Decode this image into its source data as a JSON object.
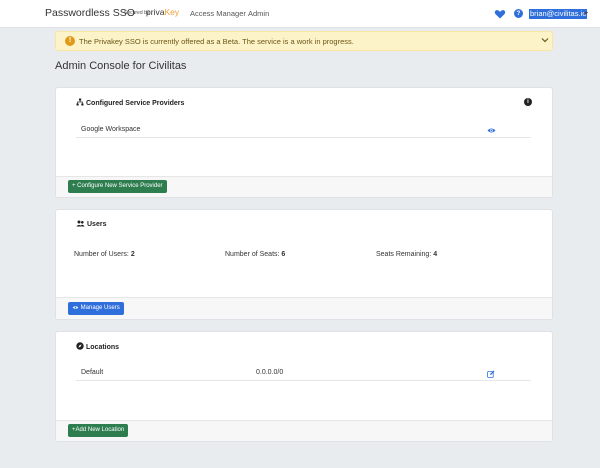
{
  "navbar": {
    "brand": "Passwordless SSO",
    "secured_by": "Secured by",
    "logo_prefix": "priva",
    "logo_suffix": "Key",
    "links": [
      "Access Manager",
      "Admin"
    ],
    "user_email": "brian@civilitas.io",
    "help_glyph": "?",
    "icons": [
      "heart-icon",
      "help-icon",
      "caret-down-icon"
    ]
  },
  "alert": {
    "icon_glyph": "!",
    "text": "The Privakey SSO is currently offered as a Beta. The service is a work in progress."
  },
  "page_title": "Admin Console for Civilitas",
  "service_providers": {
    "title": "Configured Service Providers",
    "info_glyph": "i",
    "items": [
      {
        "name": "Google Workspace"
      }
    ],
    "button": "Configure New Service Provider"
  },
  "users": {
    "title": "Users",
    "stats": [
      {
        "label": "Number of Users:",
        "value": "2"
      },
      {
        "label": "Number of Seats:",
        "value": "6"
      },
      {
        "label": "Seats Remaining:",
        "value": "4"
      }
    ],
    "button": "Manage Users"
  },
  "locations": {
    "title": "Locations",
    "items": [
      {
        "name": "Default",
        "range": "0.0.0.0/0"
      }
    ],
    "button": "Add New Location"
  },
  "colors": {
    "primary": "#2f6fdb",
    "success": "#2e7d4f",
    "warning_bg": "#fdf3c9",
    "warning_icon": "#e09a1a"
  }
}
